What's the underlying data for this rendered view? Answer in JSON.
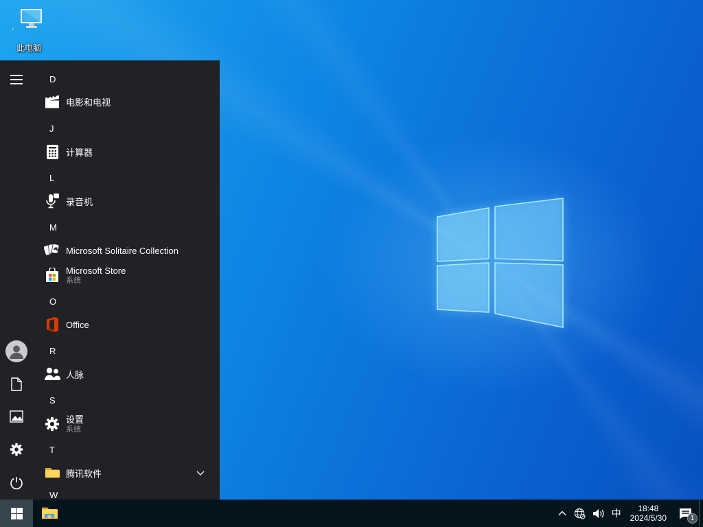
{
  "desktop": {
    "icons": [
      {
        "label": "此电脑",
        "icon": "this-pc"
      }
    ]
  },
  "start_menu": {
    "rows": [
      {
        "type": "header",
        "label": "D"
      },
      {
        "type": "app",
        "label": "电影和电视",
        "icon": "movies-tv"
      },
      {
        "type": "header",
        "label": "J"
      },
      {
        "type": "app",
        "label": "计算器",
        "icon": "calculator"
      },
      {
        "type": "header",
        "label": "L"
      },
      {
        "type": "app",
        "label": "录音机",
        "icon": "voice-recorder"
      },
      {
        "type": "header",
        "label": "M"
      },
      {
        "type": "app",
        "label": "Microsoft Solitaire Collection",
        "icon": "solitaire"
      },
      {
        "type": "app",
        "label": "Microsoft Store",
        "sublabel": "系统",
        "icon": "store"
      },
      {
        "type": "header",
        "label": "O"
      },
      {
        "type": "app",
        "label": "Office",
        "icon": "office"
      },
      {
        "type": "header",
        "label": "R"
      },
      {
        "type": "app",
        "label": "人脉",
        "icon": "people"
      },
      {
        "type": "header",
        "label": "S"
      },
      {
        "type": "app",
        "label": "设置",
        "sublabel": "系统",
        "icon": "settings"
      },
      {
        "type": "header",
        "label": "T"
      },
      {
        "type": "app",
        "label": "腾讯软件",
        "icon": "folder",
        "expandable": true
      },
      {
        "type": "header",
        "label": "W"
      }
    ],
    "rail_icons": [
      "hamburger",
      "user-avatar",
      "documents",
      "pictures",
      "settings",
      "power"
    ]
  },
  "taskbar": {
    "start_icon": "windows-logo",
    "pinned": [
      {
        "icon": "file-explorer"
      }
    ],
    "tray": {
      "hidden_icons": "chevron-up",
      "network_icon": "globe-no-internet",
      "volume_icon": "speaker",
      "ime": "中",
      "time": "18:48",
      "date": "2024/5/30",
      "notification_count": "1"
    }
  },
  "colors": {
    "taskbar_bg": "#06141e",
    "start_menu_bg": "#212225",
    "start_button_active": "#36454e",
    "wallpaper_main": "#0e86e4",
    "folder_yellow": "#ffd255",
    "office_orange": "#d83b01",
    "store_red": "#f25022",
    "store_green": "#7fba00",
    "store_blue": "#00a4ef",
    "store_yellow": "#ffb900",
    "subtitle_gray": "#9b9b9b"
  }
}
